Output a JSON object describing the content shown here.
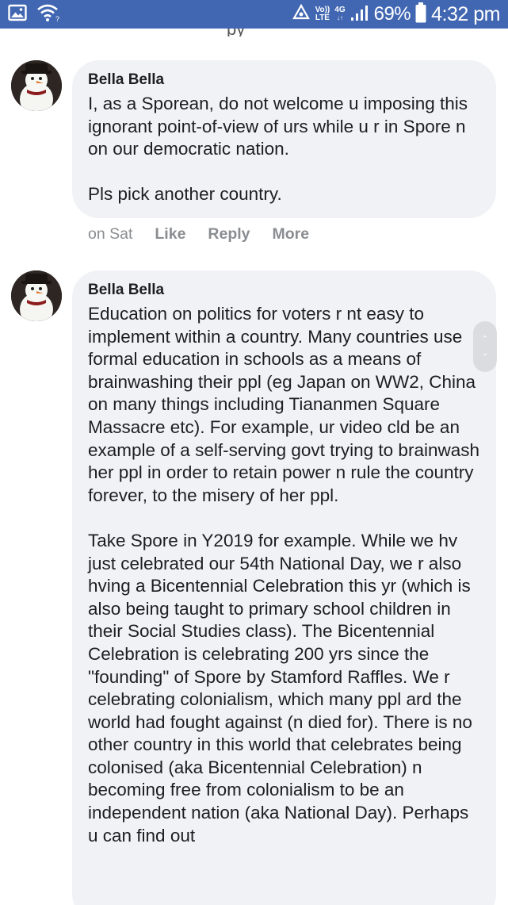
{
  "status_bar": {
    "volte_top": "Vo))",
    "volte_bottom": "LTE",
    "network_top": "4G",
    "network_bottom": "↓↑",
    "battery_percent": "69%",
    "time": "4:32 pm"
  },
  "peek_text": "py",
  "comments": [
    {
      "author": "Bella Bella",
      "text": "I, as a Sporean, do not welcome u imposing this ignorant point-of-view of urs while u r in Spore n on our democratic nation.\n\nPls pick another country.",
      "time": "on Sat",
      "like_label": "Like",
      "reply_label": "Reply",
      "more_label": "More"
    },
    {
      "author": "Bella Bella",
      "text": "Education on politics for voters r nt easy to implement within a country. Many countries use formal education in schools as a means of brainwashing their ppl (eg Japan on WW2, China on many things including Tiananmen Square Massacre etc). For example, ur video cld be an example of a self-serving govt trying to brainwash her ppl in order to retain power n rule the country forever, to the misery of her ppl.\n\nTake Spore in Y2019 for example. While we hv just celebrated our 54th National Day, we r also hving a Bicentennial Celebration this yr (which is also being taught to primary school children in their Social Studies class). The Bicentennial Celebration is celebrating 200 yrs since the \"founding\" of Spore by Stamford Raffles. We r celebrating colonialism, which many ppl ard the world had fought against (n died for). There is no other country in this world that celebrates being colonised (aka Bicentennial Celebration) n becoming free from colonialism to be an independent nation (aka National Day). Perhaps u can find out"
    }
  ],
  "icons": {
    "gallery": "image-icon",
    "wifi": "wifi-question-icon",
    "hotspot": "hotspot-icon",
    "signal": "signal-bars-icon",
    "battery": "battery-icon",
    "scroll": "scroll-handle-icon"
  },
  "colors": {
    "status_bar": "#4267b2",
    "bubble": "#f0f2f5",
    "text": "#1c1e21",
    "secondary": "#8a8d91"
  }
}
